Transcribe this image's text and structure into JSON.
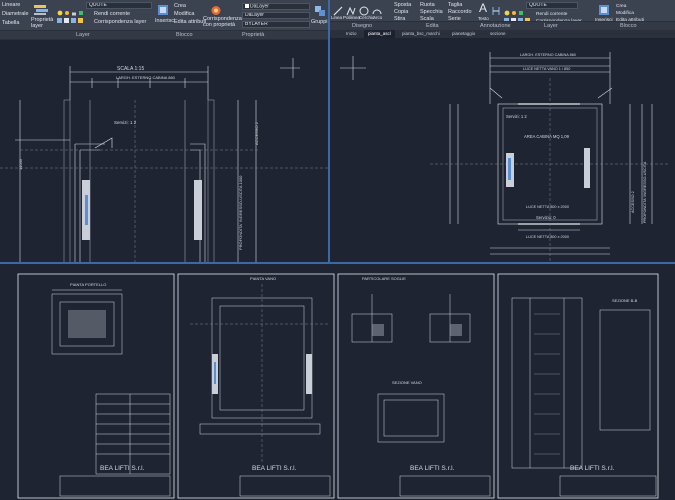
{
  "ribbon_left": {
    "linear_label": "Lineare",
    "diametral_label": "Diametrale",
    "table_label": "Tabella",
    "properties_layer_label": "Proprietà layer",
    "quote_combo": "QUOTE",
    "make_current_label": "Rendi corrente",
    "match_layer_label": "Corrispondenza layer",
    "insert_label": "Inserisci",
    "create_label": "Crea",
    "modify_label": "Modifica",
    "edit_attributes_label": "Edita attributi",
    "match_properties_label": "Corrispondenza con proprietà",
    "bylayer_1": "DaLayer",
    "bylayer_2": "DaLayer",
    "bylayer_3": "BYLAYER",
    "groups_label": "Gruppi",
    "panel_layer": "Layer",
    "panel_block": "Blocco",
    "panel_properties": "Proprietà"
  },
  "ribbon_right": {
    "line_label": "Linea",
    "polyline_label": "Polilinea",
    "circle_label": "Cerchio",
    "arc_label": "Arco",
    "move_label": "Sposta",
    "rotate_label": "Ruota",
    "trim_label": "Taglia",
    "copy_label": "Copia",
    "mirror_label": "Specchia",
    "fillet_label": "Raccordo",
    "stretch_label": "Stira",
    "scale_label": "Scala",
    "array_label": "Serie",
    "text_label": "Testo",
    "quote_combo": "QUOTE",
    "make_current_label": "Rendi corrente",
    "match_layer_label": "Corrispondenza layer",
    "insert_label": "Inserisci",
    "create_label": "Crea",
    "modify_label": "Modifica",
    "edit_attributes_label": "Edita attributi",
    "panel_draw": "Disegno",
    "panel_modify": "Edita",
    "panel_annotation": "Annotazione",
    "panel_layer": "Layer",
    "panel_block": "Blocco"
  },
  "doc_tabs": [
    "Inizio",
    "pianta_ascl",
    "pianta_bsc_marchi",
    "pianetaggio",
    "sezione"
  ],
  "drawing_top_left": {
    "scale_label": "SCALA 1:15",
    "width_label": "LARGH. ESTERNO CABINA 860",
    "services_label": "Servizi: 1 2",
    "label_depth": "PROFONDITA' INGRESSO-USCITA 1000",
    "label_access": "ACCESSO 2",
    "dim_left": "14045"
  },
  "drawing_top_right": {
    "dim_top_1": "LARGH. ESTERNO CABINA 860",
    "dim_top_2": "LUCE NETTA VANO 1 / 850",
    "services_1": "Servizi: 1 2",
    "area_label": "AREA CABINA MQ 1,09",
    "door_label_1": "LUCE NETTA 800 x 2000",
    "door_label_2": "LUCE NETTA 800 x 2000",
    "services_2": "Servizio: 0",
    "label_access": "ACCESSO 2",
    "label_depth": "PROFONDITA' INGRESSO-USCITA"
  },
  "sheets": {
    "sheet1_title": "PIANTA PORTELLO",
    "company": "BEA LIFTI S.r.l.",
    "sheet2_title": "PIANTA VANO",
    "sheet3_title_1": "PARTICOLARE SOGLIE",
    "sheet3_title_2": "SEZIONE VANO",
    "sheet4_title": "SEZIONE B-B"
  }
}
